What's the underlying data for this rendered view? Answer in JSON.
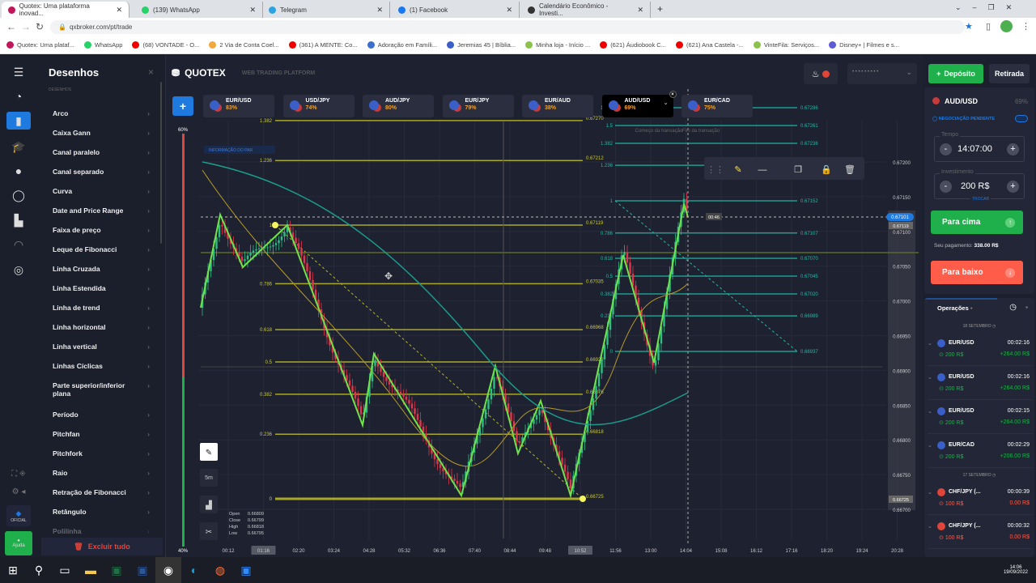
{
  "browser": {
    "tabs": [
      {
        "title": "Quotex: Uma plataforma inovad...",
        "color": "#c2185b"
      },
      {
        "title": "(139) WhatsApp",
        "color": "#25d366"
      },
      {
        "title": "Telegram",
        "color": "#2aa3e0"
      },
      {
        "title": "(1) Facebook",
        "color": "#1877f2"
      },
      {
        "title": "Calendário Econômico - Investi...",
        "color": "#333333"
      }
    ],
    "url": "qxbroker.com/pt/trade",
    "bookmarks": [
      "Quotex: Uma plataf...",
      "WhatsApp",
      "(68) VONTADE - O...",
      "2 Via de Conta Coel...",
      "(361) A MENTE: Co...",
      "Adoração em Famíli...",
      "Jeremias 45 | Bíblia...",
      "Minha loja - Início ...",
      "(621) Áudiobook C...",
      "(621) Ana Castela -...",
      "VinteFila: Serviços...",
      "Disney+ | Filmes e s..."
    ]
  },
  "drawings": {
    "title": "Desenhos",
    "section": "DESENHOS",
    "items": [
      "Arco",
      "Caixa Gann",
      "Canal paralelo",
      "Canal separado",
      "Curva",
      "Date and Price Range",
      "Faixa de preço",
      "Leque de Fibonacci",
      "Linha Cruzada",
      "Linha Estendida",
      "Linha de trend",
      "Linha horizontal",
      "Linha vertical",
      "Linhas Cíclicas",
      "Parte superior/inferior plana",
      "Período",
      "Pitchfan",
      "Pitchfork",
      "Raio",
      "Retração de Fibonacci",
      "Retângulo",
      "Polilinha"
    ],
    "delete_all": "Excluir tudo"
  },
  "rail": {
    "official": "OFICIAL",
    "help": "Ajuda"
  },
  "header": {
    "brand": "QUOTEX",
    "subtitle": "WEB TRADING PLATFORM",
    "deposit": "Depósito",
    "withdraw": "Retirada",
    "account_mask": "• • • • • • • • •"
  },
  "assets": [
    {
      "name": "EUR/USD",
      "payout": "83%"
    },
    {
      "name": "USD/JPY",
      "payout": "74%"
    },
    {
      "name": "AUD/JPY",
      "payout": "80%"
    },
    {
      "name": "EUR/JPY",
      "payout": "79%"
    },
    {
      "name": "EUR/AUD",
      "payout": "38%"
    },
    {
      "name": "AUD/USD",
      "payout": "69%",
      "active": true
    },
    {
      "name": "EUR/CAD",
      "payout": "75%"
    }
  ],
  "chart": {
    "timeframe": "5m",
    "volume_pct_top": "60%",
    "volume_pct_bottom": "40%",
    "ohlc": {
      "Open": "0.66809",
      "Close": "0.66799",
      "High": "0.66818",
      "Low": "0.66795"
    },
    "current_price": "0.67101",
    "hover_price": "0.67119",
    "price_bottom_marker": "0.66725",
    "timer": "00:46",
    "start_label": "Começo da transação",
    "end_label": "Fim da transação",
    "price_axis": [
      "0.67200",
      "0.67150",
      "0.67100",
      "0.67050",
      "0.67000",
      "0.66950",
      "0.66900",
      "0.66850",
      "0.66800",
      "0.66750",
      "0.66700"
    ],
    "time_axis": [
      "00:12",
      "01:16",
      "02:20",
      "03:24",
      "04:28",
      "05:32",
      "06:36",
      "07:40",
      "08:44",
      "09:48",
      "10:52",
      "11:56",
      "13:00",
      "14:04",
      "15:08",
      "16:12",
      "17:16",
      "18:20",
      "19:24",
      "20:28"
    ],
    "fib_left": [
      {
        "level": "1.382",
        "price": "0.67270"
      },
      {
        "level": "1.236",
        "price": "0.67212"
      },
      {
        "level": "1",
        "price": "0.67119"
      },
      {
        "level": "0.786",
        "price": "0.67035"
      },
      {
        "level": "0.618",
        "price": "0.66968"
      },
      {
        "level": "0.5",
        "price": "0.66922"
      },
      {
        "level": "0.382",
        "price": "0.66876"
      },
      {
        "level": "0.236",
        "price": "0.66818"
      },
      {
        "level": "0",
        "price": "0.66725"
      }
    ],
    "fib_right": [
      {
        "level": "1.618",
        "price": "0.67286"
      },
      {
        "level": "1.5",
        "price": "0.67261"
      },
      {
        "level": "1.382",
        "price": "0.67236"
      },
      {
        "level": "1.236",
        "price": "0.67203"
      },
      {
        "level": "1",
        "price": "0.67152"
      },
      {
        "level": "0.786",
        "price": "0.67107"
      },
      {
        "level": "0.618",
        "price": "0.67070"
      },
      {
        "level": "0.5",
        "price": "0.67045"
      },
      {
        "level": "0.382",
        "price": "0.67020"
      },
      {
        "level": "0.236",
        "price": "0.66989"
      },
      {
        "level": "0",
        "price": "0.66937"
      }
    ],
    "pending_info": "INFORMAÇÃO DO PAR"
  },
  "trade": {
    "asset": "AUD/USD",
    "payout": "69%",
    "pending": "NEGOCIAÇÃO PENDENTE",
    "time_label": "Tempo",
    "time": "14:07:00",
    "invest_label": "Investimento",
    "invest": "200 R$",
    "switch": "TROCAR",
    "up": "Para cima",
    "payment_label": "Seu pagamento:",
    "payment": "338.00 R$",
    "down": "Para baixo"
  },
  "operations": {
    "title": "Operações",
    "groups": [
      {
        "date": "18 SETEMBRO",
        "items": [
          {
            "asset": "EUR/USD",
            "time": "00:02:16",
            "amount": "200 R$",
            "result": "+264.00 R$",
            "win": true
          },
          {
            "asset": "EUR/USD",
            "time": "00:02:16",
            "amount": "200 R$",
            "result": "+264.00 R$",
            "win": true
          },
          {
            "asset": "EUR/USD",
            "time": "00:02:15",
            "amount": "200 R$",
            "result": "+264.00 R$",
            "win": true
          },
          {
            "asset": "EUR/CAD",
            "time": "00:02:29",
            "amount": "200 R$",
            "result": "+206.00 R$",
            "win": true
          }
        ]
      },
      {
        "date": "17 SETEMBRO",
        "items": [
          {
            "asset": "CHF/JPY (...",
            "time": "00:00:39",
            "amount": "100 R$",
            "result": "0.00 R$",
            "win": false
          },
          {
            "asset": "CHF/JPY (...",
            "time": "00:00:32",
            "amount": "100 R$",
            "result": "0.00 R$",
            "win": false
          }
        ]
      }
    ]
  },
  "taskbar": {
    "time": "14:06",
    "date": "19/09/2022"
  },
  "colors": {
    "accent": "#1f7ae0",
    "up": "#20b04b",
    "down": "#ff5c4a",
    "fib_left": "#b5b52a",
    "fib_right": "#25b7a5",
    "bg": "#1e2130"
  }
}
